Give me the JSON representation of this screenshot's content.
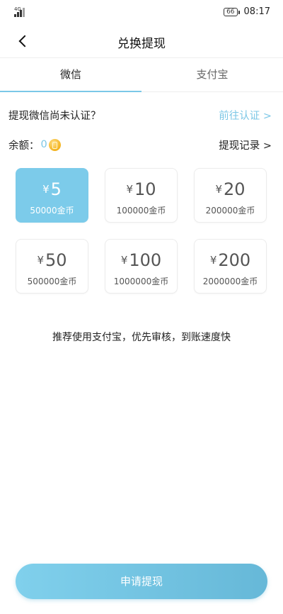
{
  "status_bar": {
    "network": "4G",
    "battery": "66",
    "time": "08:17"
  },
  "header": {
    "title": "兑换提现"
  },
  "tabs": [
    {
      "label": "微信",
      "active": true
    },
    {
      "label": "支付宝",
      "active": false
    }
  ],
  "cert": {
    "text": "提现微信尚未认证？",
    "link": "前往认证 >"
  },
  "balance": {
    "label": "余额：",
    "value": "0",
    "coin_icon": "gold-coin-icon",
    "records_link": "提现记录 >"
  },
  "currency_symbol": "¥",
  "amounts": [
    {
      "value": "5",
      "coins": "50000金币",
      "selected": true
    },
    {
      "value": "10",
      "coins": "100000金币",
      "selected": false
    },
    {
      "value": "20",
      "coins": "200000金币",
      "selected": false
    },
    {
      "value": "50",
      "coins": "500000金币",
      "selected": false
    },
    {
      "value": "100",
      "coins": "1000000金币",
      "selected": false
    },
    {
      "value": "200",
      "coins": "2000000金币",
      "selected": false
    }
  ],
  "recommend_text": "推荐使用支付宝，优先审核，到账速度快",
  "submit_label": "申请提现",
  "colors": {
    "accent": "#7ccbea",
    "link": "#7cc7e6",
    "button_start": "#80d0ec",
    "button_end": "#66b8d8"
  }
}
